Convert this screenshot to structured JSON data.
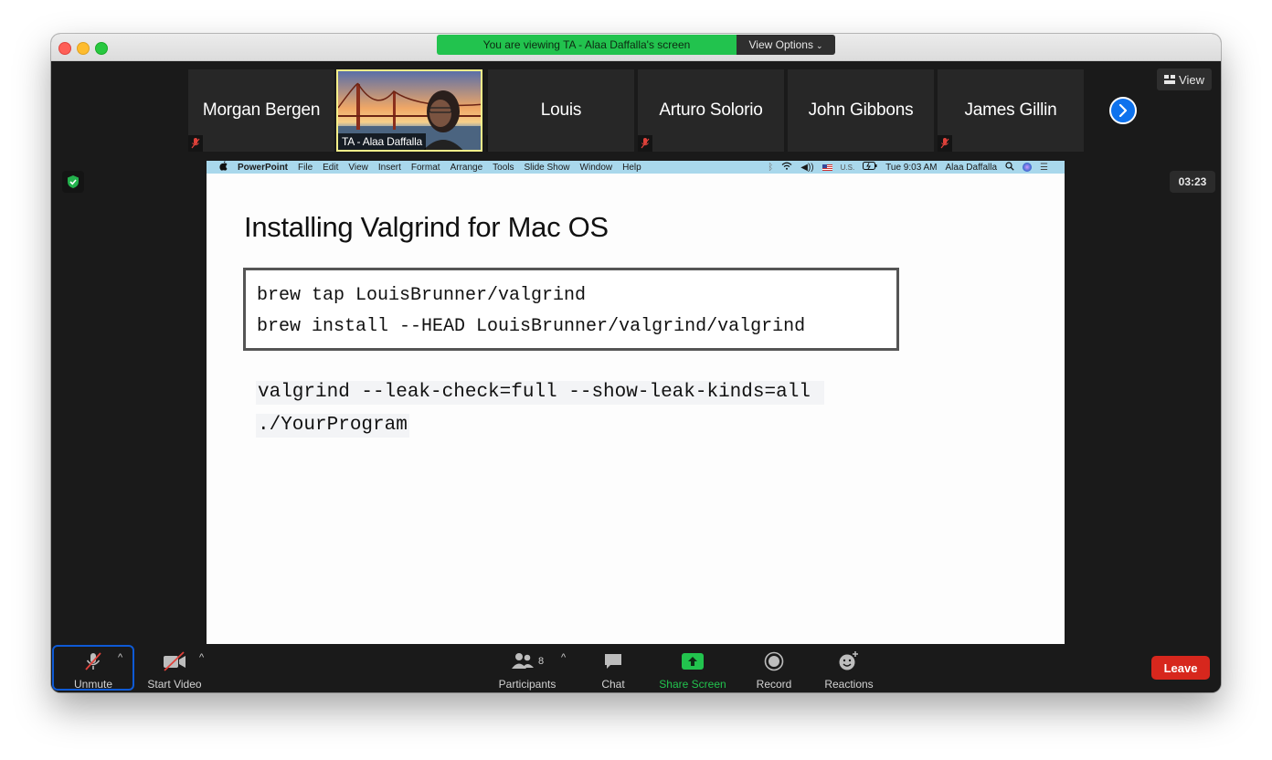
{
  "banner": {
    "viewing_text": "You are viewing TA - Alaa Daffalla's screen",
    "view_options_label": "View Options"
  },
  "participants_strip": [
    {
      "name": "Morgan Bergen",
      "muted": true
    },
    {
      "name": "TA - Alaa Daffalla",
      "muted": true,
      "active_speaker": true
    },
    {
      "name": "Louis",
      "muted": false
    },
    {
      "name": "Arturo Solorio",
      "muted": true
    },
    {
      "name": "John Gibbons",
      "muted": false
    },
    {
      "name": "James Gillin",
      "muted": true
    }
  ],
  "view_button_label": "View",
  "timer": "03:23",
  "mac_menubar": {
    "app": "PowerPoint",
    "items": [
      "File",
      "Edit",
      "View",
      "Insert",
      "Format",
      "Arrange",
      "Tools",
      "Slide Show",
      "Window",
      "Help"
    ],
    "input_source": "U.S.",
    "clock": "Tue 9:03 AM",
    "user": "Alaa Daffalla"
  },
  "slide": {
    "title": "Installing Valgrind for Mac OS",
    "code_lines": [
      "brew tap LouisBrunner/valgrind",
      "brew install --HEAD LouisBrunner/valgrind/valgrind"
    ],
    "command_lines": [
      "valgrind --leak-check=full --show-leak-kinds=all ",
      "./YourProgram"
    ]
  },
  "toolbar": {
    "unmute": "Unmute",
    "start_video": "Start Video",
    "participants": "Participants",
    "participants_count": "8",
    "chat": "Chat",
    "share_screen": "Share Screen",
    "record": "Record",
    "reactions": "Reactions",
    "leave": "Leave"
  },
  "colors": {
    "share_green": "#22c34e",
    "leave_red": "#d7271d",
    "accent_blue": "#0e72ed"
  }
}
